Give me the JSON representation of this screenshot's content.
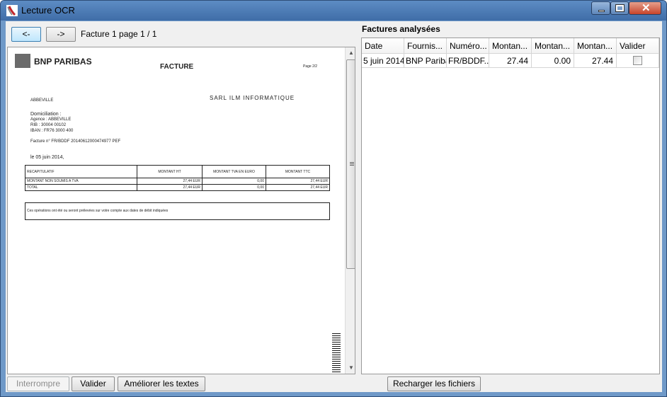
{
  "window": {
    "title": "Lecture OCR"
  },
  "nav": {
    "prev_label": "<-",
    "next_label": "->",
    "page_label": "Facture 1 page 1 / 1"
  },
  "document": {
    "bank": "BNP PARIBAS",
    "title": "FACTURE",
    "page": "Page 2/2",
    "city": "ABBEVILLE",
    "recipient": "SARL ILM INFORMATIQUE",
    "domiciliation_title": "Domiciliation :",
    "lines": [
      "Agence  : ABBEVILLE",
      "RIB      : 30004 00102",
      "IBAN     : FR76 3000 400"
    ],
    "invoice_ref": "Facture n° FR/BDDF 20140612000474977 PEF",
    "date_line": "le 05 juin 2014,",
    "table_headers": [
      "RECAPITULATIF",
      "MONTANT HT",
      "MONTANT TVA EN EURO",
      "MONTANT TTC"
    ],
    "table_rows": [
      [
        "MONTANT NON SOUMIS A TVA",
        "27,44 EUR",
        "0,00",
        "27,44 EUR"
      ],
      [
        "TOTAL",
        "27,44 EUR",
        "0,00",
        "27,44 EUR"
      ]
    ],
    "note": "Ces opérations ont été ou seront prélevées sur votre compte aux dates de débit indiquées"
  },
  "panel": {
    "title": "Factures analysées",
    "columns": [
      "Date",
      "Fournis...",
      "Numéro...",
      "Montan...",
      "Montan...",
      "Montan...",
      "Valider"
    ],
    "rows": [
      {
        "date": "5 juin 2014",
        "fournisseur": "BNP Paribas",
        "numero": "FR/BDDF...",
        "montant_ht": "27.44",
        "montant_tva": "0.00",
        "montant_ttc": "27.44",
        "valider": false
      }
    ]
  },
  "buttons": {
    "interrompre": "Interrompre",
    "valider": "Valider",
    "ameliorer": "Améliorer les textes",
    "recharger": "Recharger les fichiers"
  }
}
